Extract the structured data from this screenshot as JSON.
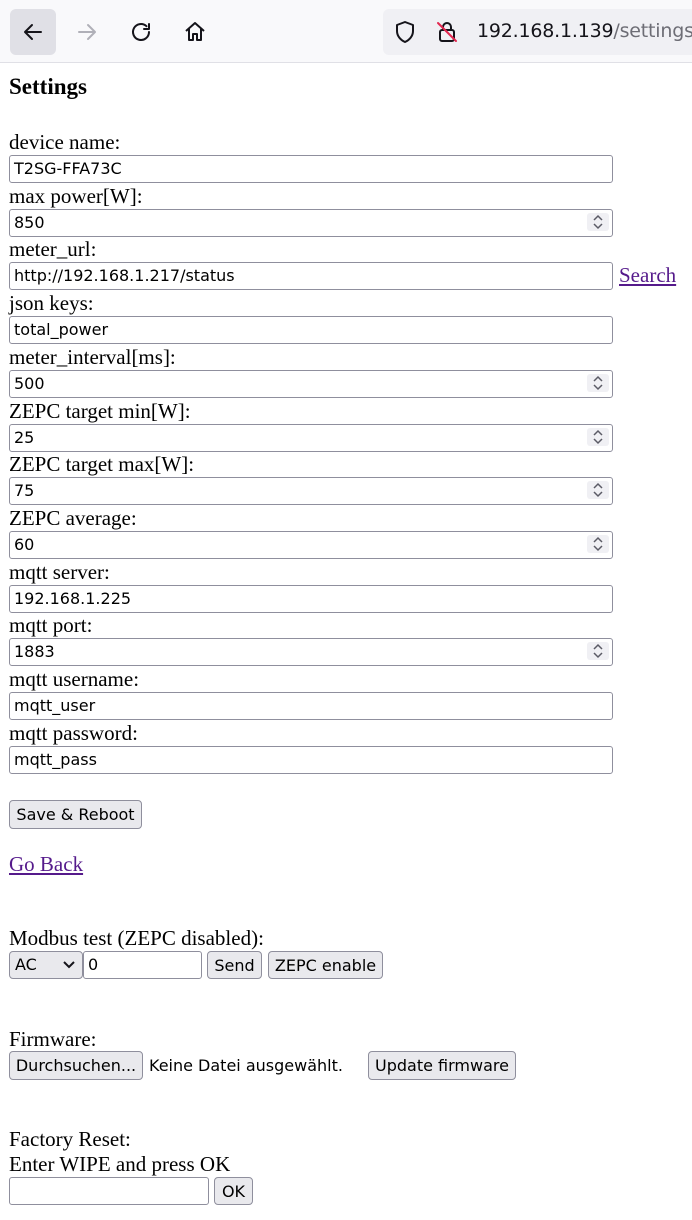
{
  "browser": {
    "url_host": "192.168.1.139",
    "url_path": "/settings"
  },
  "page": {
    "title": "Settings",
    "fields": [
      {
        "label": "device name:",
        "value": "T2SG-FFA73C",
        "number": false
      },
      {
        "label": "max power[W]:",
        "value": "850",
        "number": true
      },
      {
        "label": "meter_url:",
        "value": "http://192.168.1.217/status",
        "number": false,
        "link": "Search"
      },
      {
        "label": "json keys:",
        "value": "total_power",
        "number": false
      },
      {
        "label": "meter_interval[ms]:",
        "value": "500",
        "number": true
      },
      {
        "label": "ZEPC target min[W]:",
        "value": "25",
        "number": true
      },
      {
        "label": "ZEPC target max[W]:",
        "value": "75",
        "number": true
      },
      {
        "label": "ZEPC average:",
        "value": "60",
        "number": true
      },
      {
        "label": "mqtt server:",
        "value": "192.168.1.225",
        "number": false
      },
      {
        "label": "mqtt port:",
        "value": "1883",
        "number": true
      },
      {
        "label": "mqtt username:",
        "value": "mqtt_user",
        "number": false
      },
      {
        "label": "mqtt password:",
        "value": "mqtt_pass",
        "number": false
      }
    ],
    "save_button": "Save & Reboot",
    "go_back_link": "Go Back",
    "modbus": {
      "label": "Modbus test (ZEPC disabled):",
      "select_value": "AC",
      "input_value": "0",
      "send_button": "Send",
      "zepc_button": "ZEPC enable"
    },
    "firmware": {
      "label": "Firmware:",
      "browse_button": "Durchsuchen...",
      "no_file_text": "Keine Datei ausgewählt.",
      "update_button": "Update firmware"
    },
    "factory_reset": {
      "label": "Factory Reset:",
      "instruction": "Enter WIPE and press OK",
      "input_value": "",
      "ok_button": "OK"
    }
  }
}
